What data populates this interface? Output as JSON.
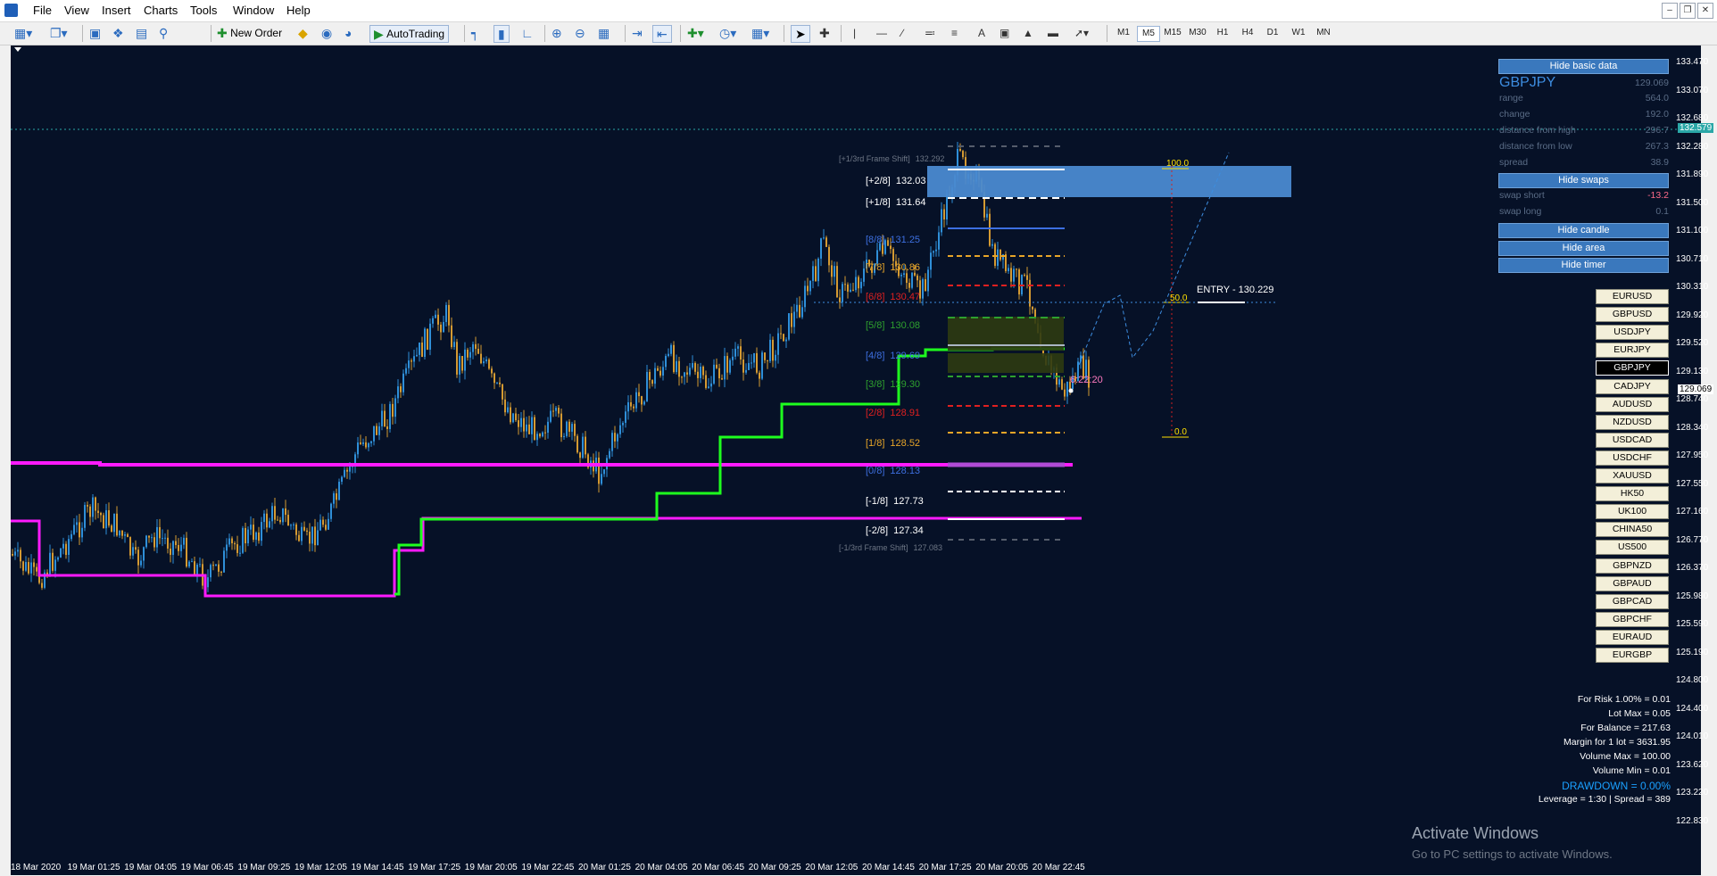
{
  "menu": [
    "File",
    "View",
    "Insert",
    "Charts",
    "Tools",
    "Window",
    "Help"
  ],
  "toolbar": {
    "new_order": "New Order",
    "autotrading": "AutoTrading",
    "timeframes": [
      "M1",
      "M5",
      "M15",
      "M30",
      "H1",
      "H4",
      "D1",
      "W1",
      "MN"
    ],
    "active_timeframe": "M5"
  },
  "chart": {
    "symbol": "GBPJPY",
    "current_price": "129.069",
    "bid_line_price": "132.579",
    "countdown": "6:22:20",
    "price_ticks": [
      "133.470",
      "133.070",
      "132.680",
      "132.280",
      "131.890",
      "131.500",
      "131.100",
      "130.710",
      "130.310",
      "129.920",
      "129.520",
      "129.130",
      "128.740",
      "128.340",
      "127.950",
      "127.550",
      "127.160",
      "126.770",
      "126.370",
      "125.980",
      "125.590",
      "125.190",
      "124.800",
      "124.400",
      "124.010",
      "123.620",
      "123.220",
      "122.830"
    ],
    "date_ticks": [
      "18 Mar 2020",
      "19 Mar 01:25",
      "19 Mar 04:05",
      "19 Mar 06:45",
      "19 Mar 09:25",
      "19 Mar 12:05",
      "19 Mar 14:45",
      "19 Mar 17:25",
      "19 Mar 20:05",
      "19 Mar 22:45",
      "20 Mar 01:25",
      "20 Mar 04:05",
      "20 Mar 06:45",
      "20 Mar 09:25",
      "20 Mar 12:05",
      "20 Mar 14:45",
      "20 Mar 17:25",
      "20 Mar 20:05",
      "20 Mar 22:45"
    ],
    "murrey": [
      {
        "label": "[+1/3rd Frame Shift]",
        "value": "132.292",
        "color": "#6d7685"
      },
      {
        "label": "[+2/8]",
        "value": "132.03",
        "color": "#ffffff"
      },
      {
        "label": "[+1/8]",
        "value": "131.64",
        "color": "#ffffff"
      },
      {
        "label": "[8/8]",
        "value": "131.25",
        "color": "#3d6fe0"
      },
      {
        "label": "[7/8]",
        "value": "130.86",
        "color": "#e7a528"
      },
      {
        "label": "[6/8]",
        "value": "130.47",
        "color": "#e02020"
      },
      {
        "label": "[5/8]",
        "value": "130.08",
        "color": "#2ea02e"
      },
      {
        "label": "[4/8]",
        "value": "129.69",
        "color": "#3d6fe0"
      },
      {
        "label": "[3/8]",
        "value": "129.30",
        "color": "#2ea02e"
      },
      {
        "label": "[2/8]",
        "value": "128.91",
        "color": "#e02020"
      },
      {
        "label": "[1/8]",
        "value": "128.52",
        "color": "#e7a528"
      },
      {
        "label": "[0/8]",
        "value": "128.13",
        "color": "#3d6fe0"
      },
      {
        "label": "[-1/8]",
        "value": "127.73",
        "color": "#ffffff"
      },
      {
        "label": "[-2/8]",
        "value": "127.34",
        "color": "#ffffff"
      },
      {
        "label": "[-1/3rd Frame Shift]",
        "value": "127.083",
        "color": "#6d7685"
      }
    ],
    "fib": {
      "top": "100.0",
      "mid": "50.0",
      "bottom": "0.0"
    },
    "entry": "ENTRY - 130.229"
  },
  "panel": {
    "hide_basic": "Hide basic data",
    "symbol": "GBPJPY",
    "symbol_price": "129.069",
    "rows": [
      {
        "label": "range",
        "value": "564.0"
      },
      {
        "label": "change",
        "value": "192.0"
      },
      {
        "label": "distance from high",
        "value": "296.7"
      },
      {
        "label": "distance from low",
        "value": "267.3"
      },
      {
        "label": "spread",
        "value": "38.9"
      }
    ],
    "hide_swaps": "Hide swaps",
    "swap_short_label": "swap short",
    "swap_short": "-13.2",
    "swap_long_label": "swap long",
    "swap_long": "0.1",
    "hide_candle": "Hide candle",
    "hide_area": "Hide area",
    "hide_timer": "Hide timer"
  },
  "pairs": [
    "EURUSD",
    "GBPUSD",
    "USDJPY",
    "EURJPY",
    "GBPJPY",
    "CADJPY",
    "AUDUSD",
    "NZDUSD",
    "USDCAD",
    "USDCHF",
    "XAUUSD",
    "HK50",
    "UK100",
    "CHINA50",
    "US500",
    "GBPNZD",
    "GBPAUD",
    "GBPCAD",
    "GBPCHF",
    "EURAUD",
    "EURGBP"
  ],
  "selected_pair": "GBPJPY",
  "stats": [
    "For Risk 1.00% = 0.01",
    "Lot Max = 0.05",
    "For Balance = 217.63",
    "Margin for 1 lot = 3631.95",
    "Volume Max = 100.00",
    "Volume Min = 0.01",
    "DRAWDOWN =  0.00%",
    "Leverage = 1:30 | Spread = 389"
  ],
  "watermark": {
    "title": "Activate Windows",
    "subtitle": "Go to PC settings to activate Windows."
  },
  "colors": {
    "chart_bg": "#061127",
    "bull": "#2f8fd8",
    "bear": "#d49a32",
    "magenta": "#ff1aff",
    "green": "#1eff1e",
    "panel_btn": "#3a78bd"
  }
}
